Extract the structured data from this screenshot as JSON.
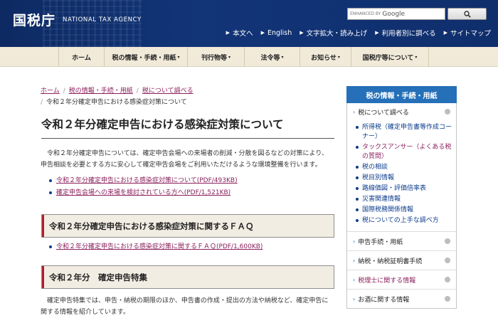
{
  "header": {
    "logo_jp": "国税庁",
    "logo_en": "NATIONAL TAX AGENCY",
    "search": {
      "enhanced_by": "ENHANCED BY",
      "google": "Google"
    },
    "util_links": [
      "本文へ",
      "English",
      "文字拡大・読み上げ",
      "利用者別に調べる",
      "サイトマップ"
    ]
  },
  "gnav": [
    {
      "label": "ホーム",
      "caret": ""
    },
    {
      "label": "税の情報・手続・用紙",
      "caret": "▾"
    },
    {
      "label": "刊行物等",
      "caret": "▾"
    },
    {
      "label": "法令等",
      "caret": "▾"
    },
    {
      "label": "お知らせ",
      "caret": "▾"
    },
    {
      "label": "国税庁等について",
      "caret": "▾"
    }
  ],
  "breadcrumb": {
    "links": [
      "ホーム",
      "税の情報・手続・用紙",
      "税について調べる"
    ],
    "separator": "/",
    "current": "令和２年分確定申告における感染症対策について"
  },
  "main": {
    "title": "令和２年分確定申告における感染症対策について",
    "intro": "令和２年分確定申告については、確定申告会場への来場者の削減・分散を図るなどの対策により、申告相談を必要とする方に安心して確定申告会場をご利用いただけるような環境整備を行います。",
    "links1": [
      "令和２年分確定申告における感染症対策について(PDF/493KB)",
      "確定申告会場への来場を検討されている方へ(PDF/1,521KB)"
    ],
    "h2_faq": "令和２年分確定申告における感染症対策に関するＦＡＱ",
    "links2": [
      "令和２年分確定申告における感染症対策に関するＦＡＱ(PDF/1,600KB)"
    ],
    "h2_special": "令和２年分　確定申告特集",
    "para2": "確定申告特集では、申告・納税の期限のほか、申告書の作成・提出の方法や納税など、確定申告に関する情報を紹介しています。"
  },
  "sidebar": {
    "title": "税の情報・手続・用紙",
    "top_row": "税について調べる",
    "sub_items": [
      {
        "label": "所得税（確定申告書等作成コーナー）",
        "pink": false
      },
      {
        "label": "タックスアンサー（よくある税の質問）",
        "pink": true
      },
      {
        "label": "税の相談",
        "pink": false
      },
      {
        "label": "税目別情報",
        "pink": false
      },
      {
        "label": "路線価図・評価倍率表",
        "pink": false
      },
      {
        "label": "災害関連情報",
        "pink": false
      },
      {
        "label": "国際税務関係情報",
        "pink": false
      },
      {
        "label": "税についての上手な調べ方",
        "pink": false
      }
    ],
    "rows": [
      {
        "label": "申告手続・用紙",
        "pink": false
      },
      {
        "label": "納税・納税証明書手続",
        "pink": false
      },
      {
        "label": "税理士に関する情報",
        "pink": true
      },
      {
        "label": "お酒に関する情報",
        "pink": false
      }
    ]
  },
  "colors": {
    "header_bg": "#0f2e6c",
    "nav_bg": "#f1ead9",
    "link": "#8a1f5b",
    "sidebar_head": "#2570b8",
    "accent_red": "#b0202c"
  }
}
